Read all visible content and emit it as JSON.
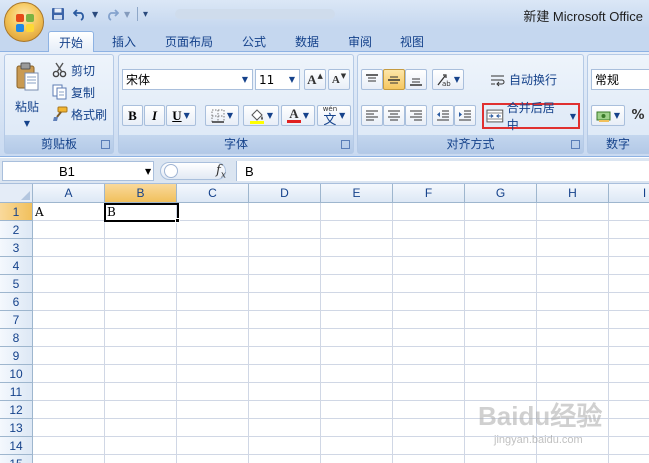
{
  "window": {
    "title": "新建 Microsoft Office"
  },
  "quick_access": {
    "save": "save-icon",
    "undo": "undo-icon",
    "redo": "redo-icon",
    "customize": "chevron-down-icon"
  },
  "tabs": [
    {
      "label": "开始",
      "active": true
    },
    {
      "label": "插入"
    },
    {
      "label": "页面布局"
    },
    {
      "label": "公式"
    },
    {
      "label": "数据"
    },
    {
      "label": "审阅"
    },
    {
      "label": "视图"
    }
  ],
  "ribbon": {
    "clipboard": {
      "label": "剪贴板",
      "paste": "粘贴",
      "cut": "剪切",
      "copy": "复制",
      "format_painter": "格式刷"
    },
    "font": {
      "label": "字体",
      "font_name": "宋体",
      "font_size": "11",
      "bold": "B",
      "italic": "I",
      "underline": "U",
      "font_color_letter": "A",
      "phonetic": "文",
      "phonetic_top": "wén",
      "grow": "A",
      "shrink": "A"
    },
    "alignment": {
      "label": "对齐方式",
      "wrap_text": "自动换行",
      "merge_center": "合并后居中"
    },
    "number": {
      "label": "数字",
      "format": "常规",
      "percent": "%"
    }
  },
  "formula_bar": {
    "name_box": "B1",
    "fx": "fx",
    "content": "B"
  },
  "sheet": {
    "columns": [
      "A",
      "B",
      "C",
      "D",
      "E",
      "F",
      "G",
      "H",
      "I"
    ],
    "rows": [
      "1",
      "2",
      "3",
      "4",
      "5",
      "6",
      "7",
      "8",
      "9",
      "10",
      "11",
      "12",
      "13",
      "14",
      "15"
    ],
    "cells": {
      "A1": "A",
      "B1": "B"
    },
    "active_cell": "B1"
  },
  "watermark": {
    "main": "Baidu经验",
    "sub": "jingyan.baidu.com"
  },
  "colors": {
    "accent": "#15428b",
    "ribbon": "#dbe7f6",
    "highlight": "#f1c05c",
    "merge_border": "#e03030"
  }
}
